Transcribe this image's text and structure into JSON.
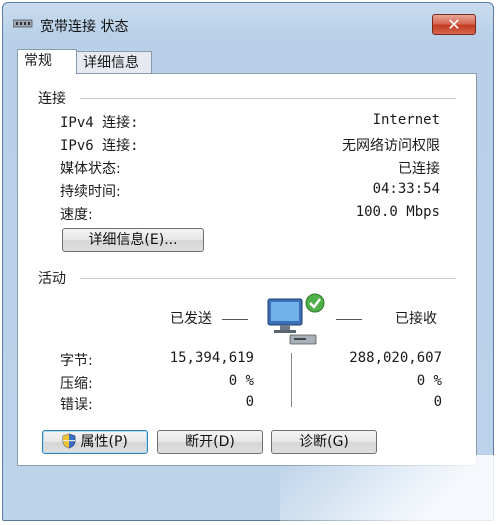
{
  "window": {
    "title": "宽带连接 状态",
    "close_glyph": "✕"
  },
  "tabs": [
    {
      "label": "常规"
    },
    {
      "label": "详细信息"
    }
  ],
  "connection": {
    "heading": "连接",
    "rows": [
      {
        "label": "IPv4 连接:",
        "value": "Internet"
      },
      {
        "label": "IPv6 连接:",
        "value": "无网络访问权限"
      },
      {
        "label": "媒体状态:",
        "value": "已连接"
      },
      {
        "label": "持续时间:",
        "value": "04:33:54"
      },
      {
        "label": "速度:",
        "value": "100.0 Mbps"
      }
    ],
    "details_button": "详细信息(E)..."
  },
  "activity": {
    "heading": "活动",
    "sent_label": "已发送",
    "received_label": "已接收",
    "rows": [
      {
        "label": "字节:",
        "sent": "15,394,619",
        "received": "288,020,607"
      },
      {
        "label": "压缩:",
        "sent": "0 %",
        "received": "0 %"
      },
      {
        "label": "错误:",
        "sent": "0",
        "received": "0"
      }
    ]
  },
  "buttons": {
    "properties": "属性(P)",
    "disconnect": "断开(D)",
    "diagnose": "诊断(G)"
  },
  "icons": {
    "title": "network-adapter-icon",
    "activity": "network-computer-icon",
    "properties": "shield-icon"
  }
}
